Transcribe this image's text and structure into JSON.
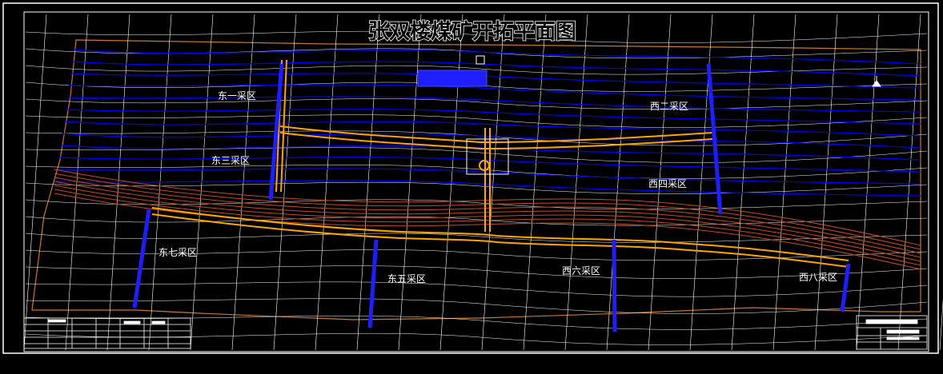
{
  "title": "张双楼煤矿开拓平面图",
  "zones": {
    "east1": "东一采区",
    "east3": "东三采区",
    "east5": "东五采区",
    "east7": "东七采区",
    "west2": "西二采区",
    "west4": "西四采区",
    "west6": "西六采区",
    "west8": "西八采区"
  },
  "colors": {
    "background": "#000000",
    "border": "#ffffff",
    "grid": "#ffffff",
    "contour": "#0000ff",
    "roadway": "#ffa500",
    "seam": "#c84a1e",
    "boundary": "#c8782a",
    "label": "#ffffff"
  },
  "icons": {
    "north_arrow": "north-arrow-icon",
    "shaft": "shaft-marker-icon"
  }
}
